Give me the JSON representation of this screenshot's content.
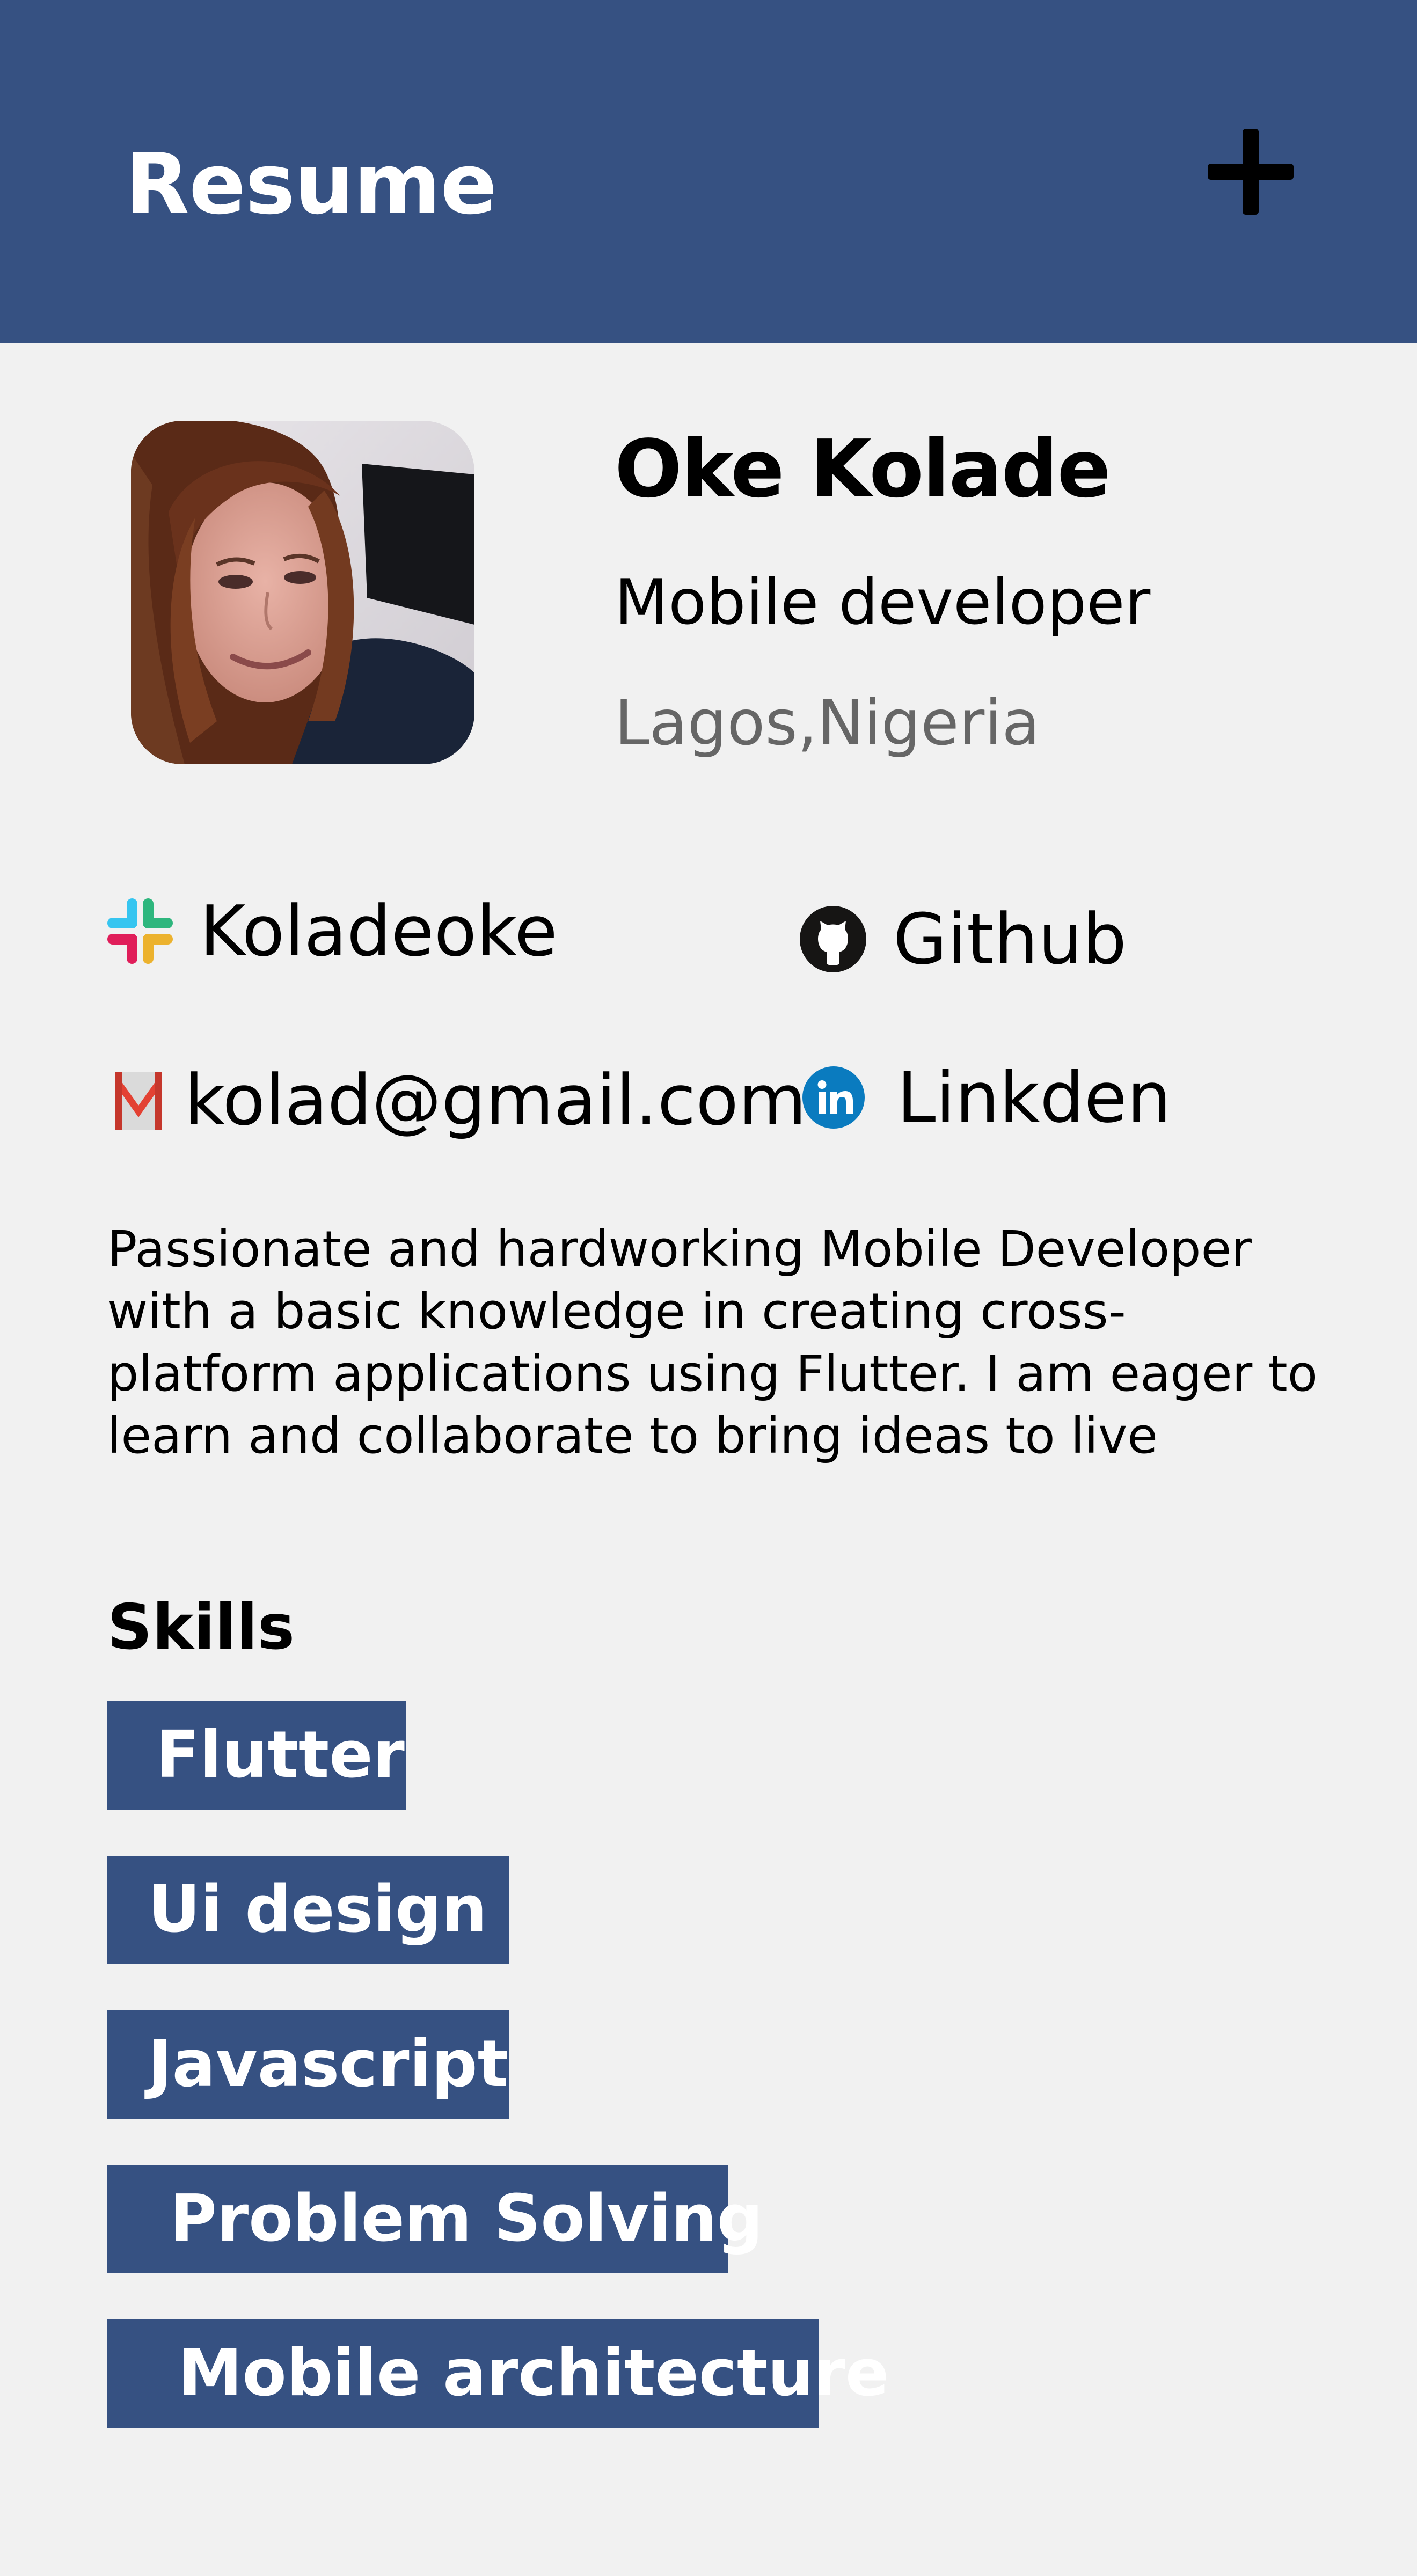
{
  "appbar": {
    "title": "Resume",
    "background": "#365182",
    "action_icon": "plus-icon"
  },
  "profile": {
    "name": "Oke Kolade",
    "role": "Mobile developer",
    "location": "Lagos,Nigeria"
  },
  "contacts": {
    "slack": {
      "icon": "slack-icon",
      "label": "Koladeoke"
    },
    "github": {
      "icon": "github-icon",
      "label": "Github"
    },
    "gmail": {
      "icon": "gmail-icon",
      "label": "kolad@gmail.com"
    },
    "linkedin": {
      "icon": "linkedin-icon",
      "label": "Linkden"
    }
  },
  "bio": "Passionate and hardworking Mobile Developer with a basic knowledge in creating cross-platform applications using Flutter. I am eager to learn and collaborate to bring ideas to live",
  "skills": {
    "heading": "Skills",
    "items": [
      "Flutter",
      "Ui design",
      "Javascript",
      "Problem Solving",
      "Mobile architecture"
    ]
  },
  "colors": {
    "primary": "#365182",
    "background": "#f1f1f1",
    "muted_text": "#666666"
  }
}
